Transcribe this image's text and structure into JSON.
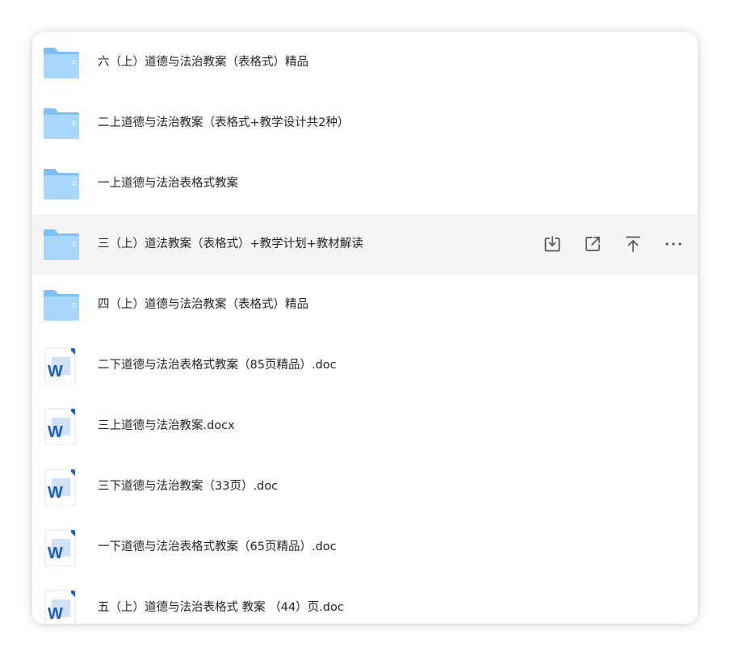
{
  "files": [
    {
      "name": "六（上）道德与法治教案（表格式）精品",
      "type": "folder",
      "icon": "folder-icon"
    },
    {
      "name": "二上道德与法治教案（表格式+教学设计共2种）",
      "type": "folder",
      "icon": "folder-icon"
    },
    {
      "name": "一上道德与法治表格式教案",
      "type": "folder",
      "icon": "folder-icon"
    },
    {
      "name": "三（上）道法教案（表格式）+教学计划+教材解读",
      "type": "folder",
      "icon": "folder-icon",
      "hovered": true
    },
    {
      "name": "四（上）道德与法治教案（表格式）精品",
      "type": "folder",
      "icon": "folder-icon"
    },
    {
      "name": "二下道德与法治表格式教案（85页精品）.doc",
      "type": "doc",
      "icon": "word-doc-icon"
    },
    {
      "name": "三上道德与法治教案.docx",
      "type": "doc",
      "icon": "word-doc-icon"
    },
    {
      "name": "三下道德与法治教案（33页）.doc",
      "type": "doc",
      "icon": "word-doc-icon"
    },
    {
      "name": "一下道德与法治表格式教案（65页精品）.doc",
      "type": "doc",
      "icon": "word-doc-icon"
    },
    {
      "name": "五（上）道德与法治表格式 教案 （44）页.doc",
      "type": "doc",
      "icon": "word-doc-icon"
    }
  ],
  "row_actions": [
    {
      "name": "download-button",
      "icon": "download-icon"
    },
    {
      "name": "share-button",
      "icon": "share-icon"
    },
    {
      "name": "pin-to-top-button",
      "icon": "pin-to-top-icon"
    },
    {
      "name": "more-button",
      "icon": "more-icon"
    }
  ],
  "colors": {
    "folder_back": "#7ec0f3",
    "folder_front": "#a9d7fb",
    "word_blue": "#1a5fc1",
    "hover_bg": "#f5f5f5",
    "text": "#262626",
    "icon_gray": "#555555"
  }
}
